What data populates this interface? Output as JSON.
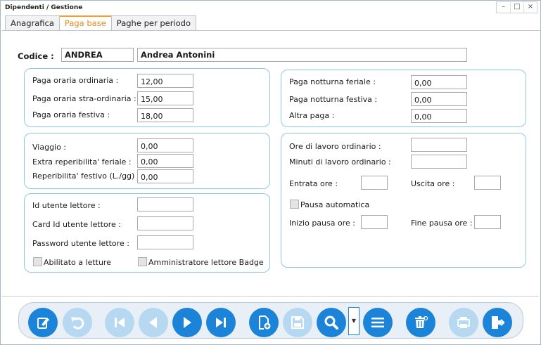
{
  "window": {
    "title": "Dipendenti / Gestione",
    "controls": [
      "–",
      "□",
      "×"
    ]
  },
  "tabs": [
    {
      "label": "Anagrafica",
      "active": false
    },
    {
      "label": "Paga base",
      "active": true
    },
    {
      "label": "Paghe per periodo",
      "active": false
    }
  ],
  "codice": {
    "label": "Codice :",
    "code": "ANDREA",
    "name": "Andrea Antonini"
  },
  "paga": {
    "ordinaria_label": "Paga oraria ordinaria :",
    "ordinaria": "12,00",
    "straordinaria_label": "Paga oraria stra-ordinaria :",
    "straordinaria": "15,00",
    "festiva_label": "Paga oraria festiva :",
    "festiva": "18,00"
  },
  "notturna": {
    "feriale_label": "Paga notturna feriale :",
    "feriale": "0,00",
    "festiva_label": "Paga notturna festiva :",
    "festiva": "0,00",
    "altra_label": "Altra paga :",
    "altra": "0,00"
  },
  "viaggio": {
    "viaggio_label": "Viaggio :",
    "viaggio": "0,00",
    "extra_label": "Extra reperibilita' feriale :",
    "extra": "0,00",
    "reperibilita_label": "Reperibilita' festivo (L./gg) :",
    "reperibilita": "0,00"
  },
  "lettore": {
    "id_label": "Id utente lettore :",
    "id": "",
    "card_label": "Card Id utente lettore :",
    "card": "",
    "password_label": "Password utente lettore :",
    "password": "",
    "abilitato_label": "Abilitato a letture",
    "admin_label": "Amministratore lettore Badge"
  },
  "orario": {
    "ore_label": "Ore di lavoro ordinario :",
    "ore": "",
    "minuti_label": "Minuti di lavoro ordinario :",
    "minuti": "",
    "entrata_label": "Entrata ore :",
    "entrata": "",
    "uscita_label": "Uscita ore :",
    "uscita": "",
    "pausa_label": "Pausa automatica",
    "inizio_label": "Inizio pausa ore :",
    "inizio": "",
    "fine_label": "Fine pausa ore :",
    "fine": ""
  },
  "colors": {
    "accent": "#1c84d8",
    "accent_disabled": "#b6d8f1",
    "tab_active": "#e58c1b",
    "group_border": "#8ec8e8"
  },
  "toolbar_icons": [
    "edit-icon",
    "undo-icon",
    "first-record-icon",
    "previous-record-icon",
    "next-record-icon",
    "last-record-icon",
    "new-record-icon",
    "save-icon",
    "search-icon",
    "list-icon",
    "delete-icon",
    "print-icon",
    "exit-icon"
  ]
}
